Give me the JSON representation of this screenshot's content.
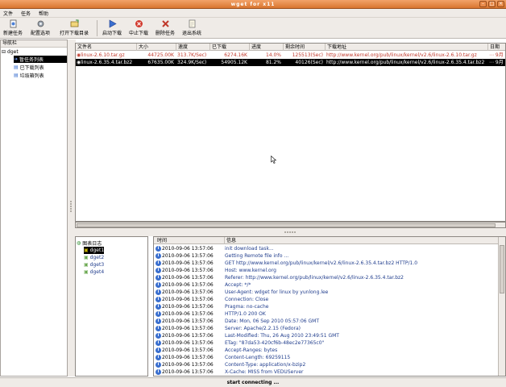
{
  "window": {
    "title": "wget for x11"
  },
  "menu": [
    "文件",
    "任务",
    "帮助"
  ],
  "toolbar": [
    {
      "label": "新建任务",
      "icon": "new-task-icon"
    },
    {
      "label": "配置选项",
      "icon": "settings-icon"
    },
    {
      "label": "打开下载目录",
      "icon": "open-folder-icon"
    },
    {
      "label": "启动下载",
      "icon": "start-icon"
    },
    {
      "label": "中止下载",
      "icon": "stop-icon"
    },
    {
      "label": "删除任务",
      "icon": "delete-icon"
    },
    {
      "label": "退出系统",
      "icon": "exit-icon"
    }
  ],
  "nav": {
    "header": "导航栏",
    "root": "dget",
    "items": [
      "暂任务列表",
      "已下载列表",
      "垃圾箱列表"
    ]
  },
  "file_table": {
    "columns": [
      "文件名",
      "大小",
      "速度",
      "已下载",
      "进度",
      "剩余时间",
      "下载地址",
      "日期"
    ],
    "rows": [
      {
        "name": "linux-2.6.10.tar.gz",
        "size": "44725.00K",
        "speed": "313.7K/Sec)",
        "downloaded": "6274.16K",
        "progress": "14.0%",
        "remaining": "125513(Sec)",
        "url": "http://www.kernel.org/pub/linux/kernel/v2.6/linux-2.6.10.tar.gz",
        "date": "⋯ 9月"
      },
      {
        "name": "linux-2.6.35.4.tar.bz2",
        "size": "67635.00K",
        "speed": "324.9K/Sec)",
        "downloaded": "54905.12K",
        "progress": "81.2%",
        "remaining": "40126(Sec)",
        "url": "http://www.kernel.org/pub/linux/kernel/v2.6/linux-2.6.35.4.tar.bz2",
        "date": "⋯ 9月"
      }
    ]
  },
  "category_tree": {
    "root": "图表日志",
    "items": [
      "dget1",
      "dget2",
      "dget3",
      "dget4"
    ]
  },
  "log": {
    "columns": [
      "时间",
      "信息"
    ],
    "rows": [
      {
        "time": "2010-09-06 13:57:06",
        "msg": "init download task..."
      },
      {
        "time": "2010-09-06 13:57:06",
        "msg": "Getting Remote file info ..."
      },
      {
        "time": "2010-09-06 13:57:06",
        "msg": "GET http://www.kernel.org/pub/linux/kernel/v2.6/linux-2.6.35.4.tar.bz2 HTTP/1.0"
      },
      {
        "time": "2010-09-06 13:57:06",
        "msg": "Host: www.kernel.org"
      },
      {
        "time": "2010-09-06 13:57:06",
        "msg": "Referer: http://www.kernel.org/pub/linux/kernel/v2.6/linux-2.6.35.4.tar.bz2"
      },
      {
        "time": "2010-09-06 13:57:06",
        "msg": "Accept: */*"
      },
      {
        "time": "2010-09-06 13:57:06",
        "msg": "User-Agent: wdget for linux by yunlong.lee"
      },
      {
        "time": "2010-09-06 13:57:06",
        "msg": "Connection: Close"
      },
      {
        "time": "2010-09-06 13:57:06",
        "msg": "Pragma: no-cache"
      },
      {
        "time": "2010-09-06 13:57:06",
        "msg": "HTTP/1.0 200 OK"
      },
      {
        "time": "2010-09-06 13:57:06",
        "msg": "Date: Mon, 06 Sep 2010 05:57:06 GMT"
      },
      {
        "time": "2010-09-06 13:57:06",
        "msg": "Server: Apache/2.2.15 (Fedora)"
      },
      {
        "time": "2010-09-06 13:57:06",
        "msg": "Last-Modified: Thu, 26 Aug 2010 23:49:51 GMT"
      },
      {
        "time": "2010-09-06 13:57:06",
        "msg": "ETag: \"87da53-420cf6b-48ec2e77365c0\""
      },
      {
        "time": "2010-09-06 13:57:06",
        "msg": "Accept-Ranges: bytes"
      },
      {
        "time": "2010-09-06 13:57:06",
        "msg": "Content-Length: 69259115"
      },
      {
        "time": "2010-09-06 13:57:06",
        "msg": "Content-Type: application/x-bzip2"
      },
      {
        "time": "2010-09-06 13:57:06",
        "msg": "X-Cache: MISS from VEDUServer"
      }
    ]
  },
  "status": {
    "text": "start connecting ..."
  },
  "colors": {
    "accent": "#d9762f",
    "link": "#1f3c8c",
    "downloading": "#c0392b",
    "selection": "#000000"
  }
}
